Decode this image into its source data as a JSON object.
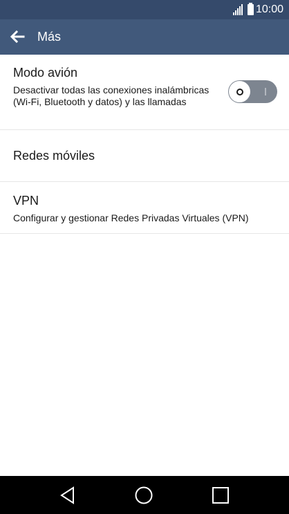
{
  "status_bar": {
    "time": "10:00",
    "icons": [
      "signal-icon",
      "battery-icon"
    ]
  },
  "app_bar": {
    "back_icon": "arrow-left-icon",
    "title": "Más"
  },
  "settings": {
    "airplane": {
      "title": "Modo avión",
      "summary": "Desactivar todas las conexiones inalámbricas (Wi-Fi, Bluetooth y datos) y las llamadas",
      "toggle_state": "off"
    },
    "mobile_networks": {
      "title": "Redes móviles"
    },
    "vpn": {
      "title": "VPN",
      "summary": "Configurar y gestionar Redes Privadas Virtuales (VPN)"
    }
  },
  "nav_bar": {
    "buttons": [
      "back-triangle-icon",
      "home-circle-icon",
      "recent-apps-square-icon"
    ]
  },
  "colors": {
    "status_bar": "#354a6b",
    "app_bar": "#41597b",
    "divider": "#e6e6e6",
    "toggle_track": "#7d8590",
    "nav_bar": "#000000"
  }
}
